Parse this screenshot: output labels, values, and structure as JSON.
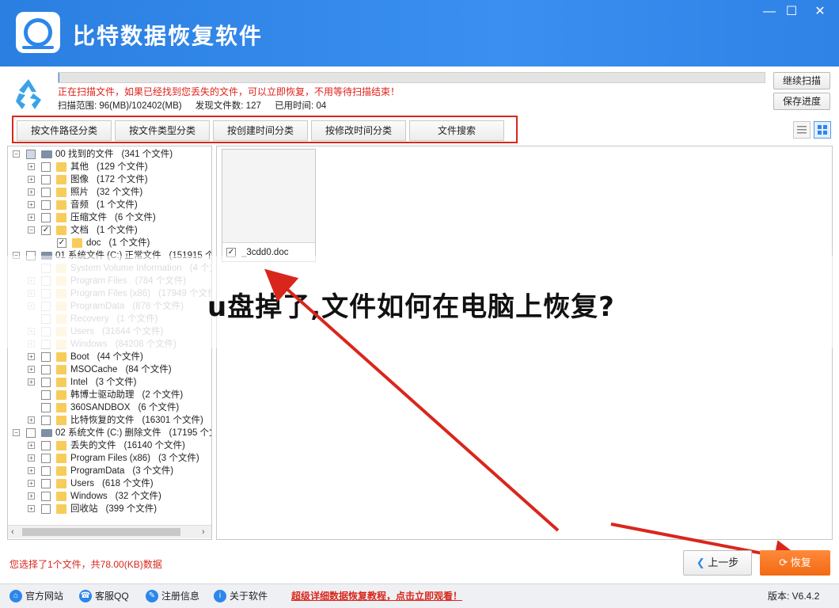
{
  "app": {
    "title": "比特数据恢复软件",
    "min": "—",
    "max": "☐",
    "close": "✕"
  },
  "scan": {
    "message": "正在扫描文件，如果已经找到您丢失的文件，可以立即恢复，不用等待扫描结束！",
    "range_label": "扫描范围: 96(MB)/102402(MB)",
    "found_label": "发现文件数: 127",
    "time_label": "已用时间: 04",
    "progress": 0.001,
    "continue_btn": "继续扫描",
    "save_btn": "保存进度"
  },
  "tabs": [
    "按文件路径分类",
    "按文件类型分类",
    "按创建时间分类",
    "按修改时间分类",
    "文件搜索"
  ],
  "tree": [
    {
      "level": 0,
      "expander": "−",
      "checked": "partial",
      "icon": "drive",
      "name": "00 找到的文件",
      "count": "(341 个文件)",
      "faded": false
    },
    {
      "level": 1,
      "expander": "+",
      "checked": "no",
      "icon": "folder",
      "name": "其他",
      "count": "(129 个文件)",
      "faded": false
    },
    {
      "level": 1,
      "expander": "+",
      "checked": "no",
      "icon": "folder",
      "name": "图像",
      "count": "(172 个文件)",
      "faded": false
    },
    {
      "level": 1,
      "expander": "+",
      "checked": "no",
      "icon": "folder",
      "name": "照片",
      "count": "(32 个文件)",
      "faded": false
    },
    {
      "level": 1,
      "expander": "+",
      "checked": "no",
      "icon": "folder",
      "name": "音频",
      "count": "(1 个文件)",
      "faded": false
    },
    {
      "level": 1,
      "expander": "+",
      "checked": "no",
      "icon": "folder",
      "name": "压缩文件",
      "count": "(6 个文件)",
      "faded": false
    },
    {
      "level": 1,
      "expander": "−",
      "checked": "yes",
      "icon": "folder",
      "name": "文档",
      "count": "(1 个文件)",
      "faded": false
    },
    {
      "level": 2,
      "expander": "",
      "checked": "yes",
      "icon": "folder",
      "name": "doc",
      "count": "(1 个文件)",
      "faded": false
    },
    {
      "level": 0,
      "expander": "−",
      "checked": "no",
      "icon": "drive",
      "name": "01 系统文件 (C:) 正常文件",
      "count": "(151915 个文",
      "faded": false
    },
    {
      "level": 1,
      "expander": "",
      "checked": "no",
      "icon": "folder",
      "name": "System Volume Information",
      "count": "(4 个文",
      "faded": true
    },
    {
      "level": 1,
      "expander": "+",
      "checked": "no",
      "icon": "folder",
      "name": "Program Files",
      "count": "(784 个文件)",
      "faded": true
    },
    {
      "level": 1,
      "expander": "+",
      "checked": "no",
      "icon": "folder",
      "name": "Program Files (x86)",
      "count": "(17949 个文件",
      "faded": true
    },
    {
      "level": 1,
      "expander": "+",
      "checked": "no",
      "icon": "folder",
      "name": "ProgramData",
      "count": "(878 个文件)",
      "faded": true
    },
    {
      "level": 1,
      "expander": "",
      "checked": "no",
      "icon": "folder",
      "name": "Recovery",
      "count": "(1 个文件)",
      "faded": true
    },
    {
      "level": 1,
      "expander": "+",
      "checked": "no",
      "icon": "folder",
      "name": "Users",
      "count": "(31644 个文件)",
      "faded": true
    },
    {
      "level": 1,
      "expander": "+",
      "checked": "no",
      "icon": "folder",
      "name": "Windows",
      "count": "(84208 个文件)",
      "faded": true
    },
    {
      "level": 1,
      "expander": "+",
      "checked": "no",
      "icon": "folder",
      "name": "Boot",
      "count": "(44 个文件)",
      "faded": false
    },
    {
      "level": 1,
      "expander": "+",
      "checked": "no",
      "icon": "folder",
      "name": "MSOCache",
      "count": "(84 个文件)",
      "faded": false
    },
    {
      "level": 1,
      "expander": "+",
      "checked": "no",
      "icon": "folder",
      "name": "Intel",
      "count": "(3 个文件)",
      "faded": false
    },
    {
      "level": 1,
      "expander": "",
      "checked": "no",
      "icon": "folder",
      "name": "韩博士驱动助理",
      "count": "(2 个文件)",
      "faded": false
    },
    {
      "level": 1,
      "expander": "",
      "checked": "no",
      "icon": "folder",
      "name": "360SANDBOX",
      "count": "(6 个文件)",
      "faded": false
    },
    {
      "level": 1,
      "expander": "+",
      "checked": "no",
      "icon": "folder",
      "name": "比特恢复的文件",
      "count": "(16301 个文件)",
      "faded": false
    },
    {
      "level": 0,
      "expander": "−",
      "checked": "no",
      "icon": "drive",
      "name": "02 系统文件 (C:) 删除文件",
      "count": "(17195 个文",
      "faded": false
    },
    {
      "level": 1,
      "expander": "+",
      "checked": "no",
      "icon": "folder",
      "name": "丢失的文件",
      "count": "(16140 个文件)",
      "faded": false
    },
    {
      "level": 1,
      "expander": "+",
      "checked": "no",
      "icon": "folder",
      "name": "Program Files (x86)",
      "count": "(3 个文件)",
      "faded": false
    },
    {
      "level": 1,
      "expander": "+",
      "checked": "no",
      "icon": "folder",
      "name": "ProgramData",
      "count": "(3 个文件)",
      "faded": false
    },
    {
      "level": 1,
      "expander": "+",
      "checked": "no",
      "icon": "folder",
      "name": "Users",
      "count": "(618 个文件)",
      "faded": false
    },
    {
      "level": 1,
      "expander": "+",
      "checked": "no",
      "icon": "folder",
      "name": "Windows",
      "count": "(32 个文件)",
      "faded": false
    },
    {
      "level": 1,
      "expander": "+",
      "checked": "no",
      "icon": "folder",
      "name": "回收站",
      "count": "(399 个文件)",
      "faded": false
    }
  ],
  "file": {
    "name": "_3cdd0.doc",
    "checked": true
  },
  "overlay": {
    "text": "u盘掉了,文件如何在电脑上恢复?"
  },
  "footer": {
    "selection": "您选择了1个文件，共78.00(KB)数据",
    "prev_btn": "上一步",
    "recover_btn": "恢复",
    "links": [
      "官方网站",
      "客服QQ",
      "注册信息",
      "关于软件"
    ],
    "promo": "超级详细数据恢复教程，点击立即观看！",
    "version": "版本: V6.4.2"
  },
  "colors": {
    "accent": "#2d86ea",
    "highlight": "#d9261c",
    "recover": "#f26a12"
  }
}
